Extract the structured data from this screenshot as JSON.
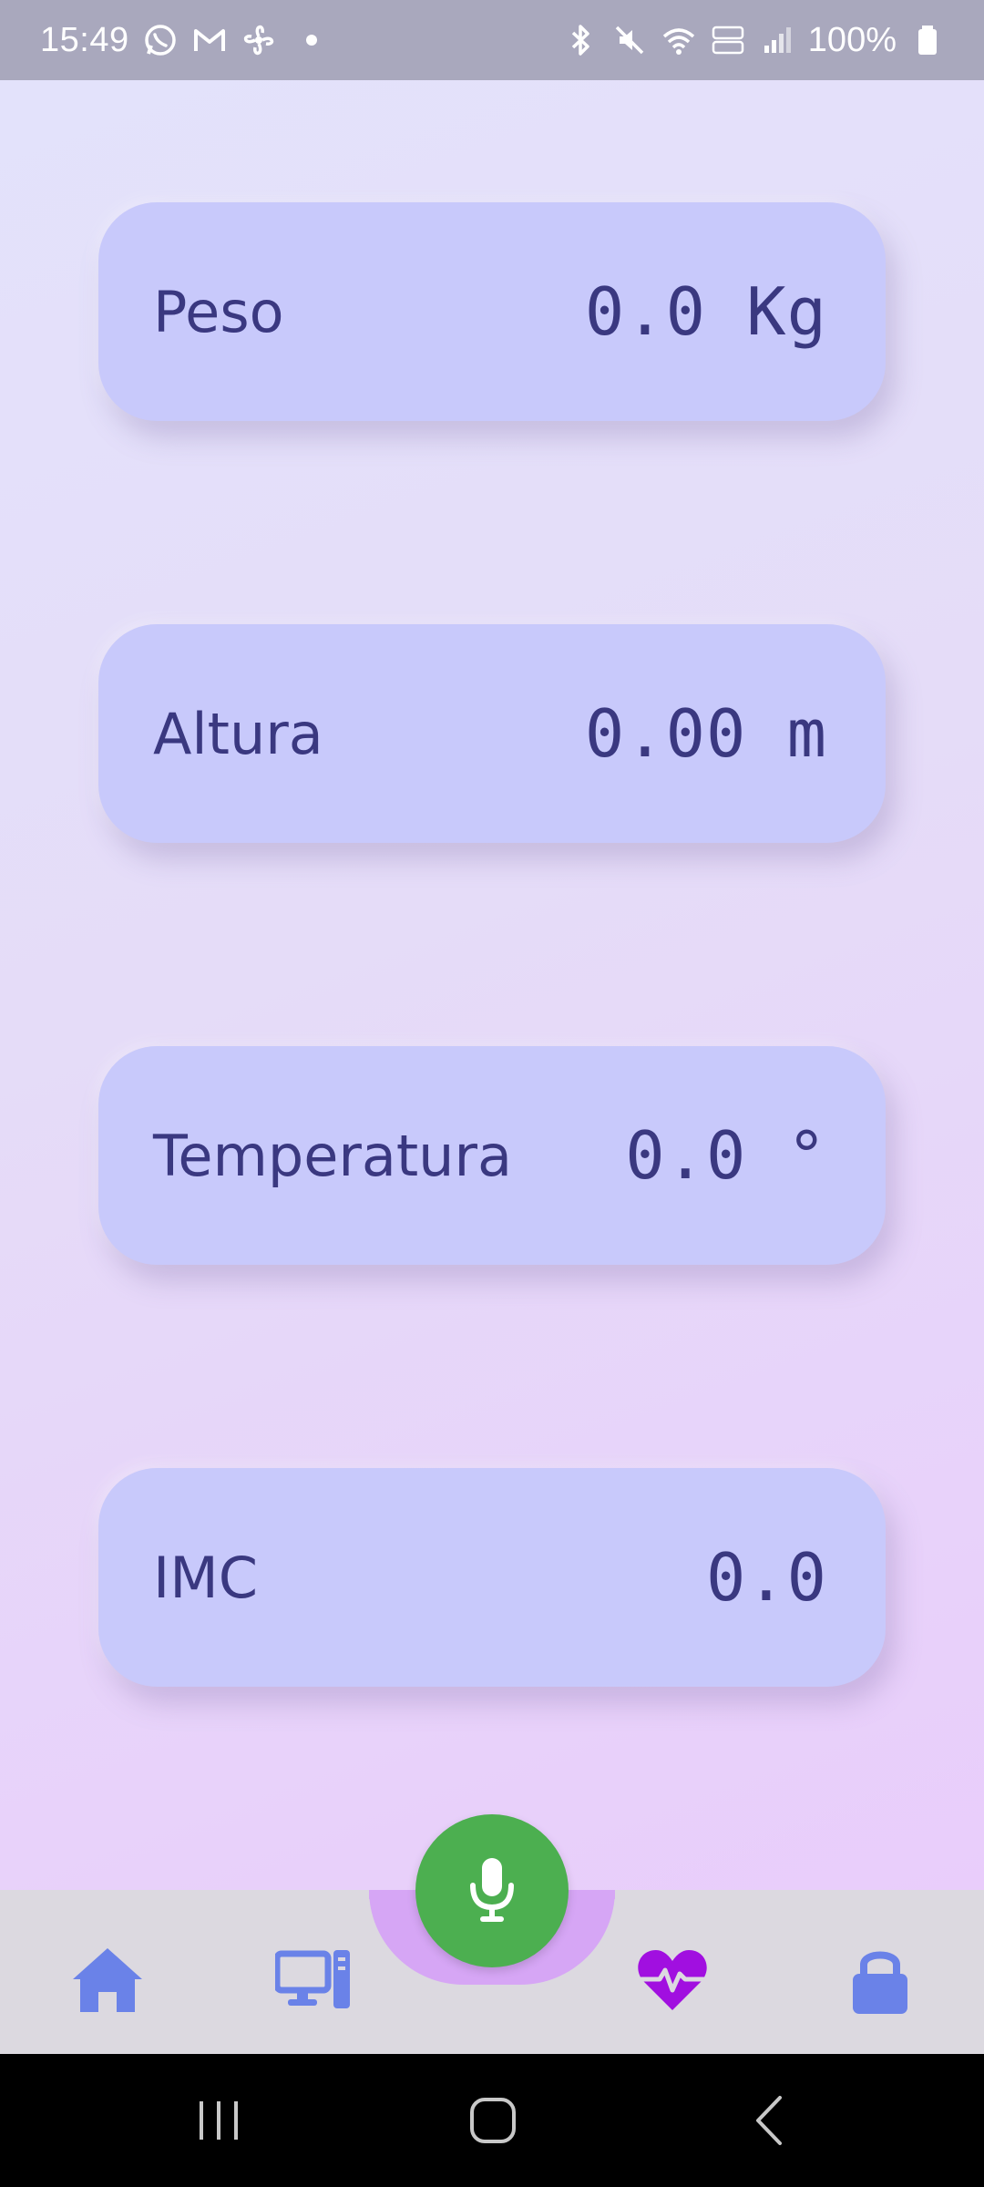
{
  "status_bar": {
    "time": "15:49",
    "battery_percent": "100%",
    "left_icons": [
      "whatsapp-icon",
      "gmail-icon",
      "fan-icon",
      "dot"
    ],
    "right_icons": [
      "bluetooth-icon",
      "mute-icon",
      "wifi-icon",
      "volte-lte-icon",
      "signal-icon",
      "battery-icon"
    ]
  },
  "cards": [
    {
      "label": "Peso",
      "value": "0.0 Kg"
    },
    {
      "label": "Altura",
      "value": "0.00 m"
    },
    {
      "label": "Temperatura",
      "value": "0.0 °"
    },
    {
      "label": "IMC",
      "value": "0.0"
    }
  ],
  "bottom_nav": {
    "items": [
      {
        "icon": "home-icon",
        "active": false
      },
      {
        "icon": "desktop-computer-icon",
        "active": false
      },
      {
        "icon": "microphone-icon",
        "active": false
      },
      {
        "icon": "heart-pulse-icon",
        "active": true
      },
      {
        "icon": "lock-icon",
        "active": false
      }
    ]
  },
  "colors": {
    "card_bg": "#c8c9fb",
    "card_text": "#3a3880",
    "mic_button": "#4caf50",
    "nav_icon": "#6a82e8",
    "nav_active": "#a10fe0",
    "nav_bg": "#dcd9e0"
  },
  "system_nav": [
    "recent-apps-icon",
    "home-button-icon",
    "back-icon"
  ]
}
